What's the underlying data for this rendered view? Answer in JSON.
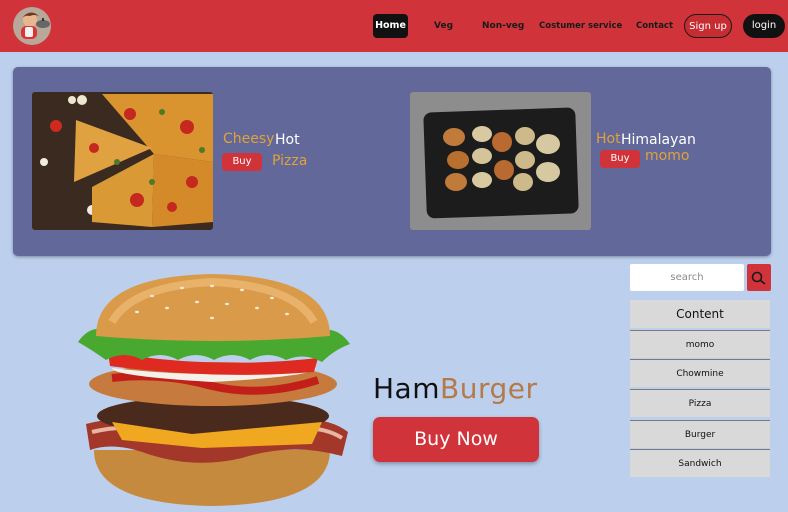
{
  "brand": {
    "logo_icon": "chef-mascot-icon"
  },
  "nav": {
    "home": "Home",
    "veg": "Veg",
    "nonveg": "Non-veg",
    "service": "Costumer service",
    "contact": "Contact",
    "signup": "Sign up",
    "login": "login"
  },
  "banner": {
    "pizza": {
      "word1": "Cheesy",
      "word2": "Hot",
      "word3": "Pizza",
      "buy": "Buy"
    },
    "momo": {
      "word1": "Hot",
      "word2": "Himalayan",
      "word3": "momo",
      "buy": "Buy"
    }
  },
  "hero": {
    "title_a": "Ham",
    "title_b": "Burger",
    "buy": "Buy Now"
  },
  "sidebar": {
    "search_placeholder": "search",
    "content_label": "Content",
    "items": [
      "momo",
      "Chowmine",
      "Pizza",
      "Burger",
      "Sandwich"
    ]
  },
  "colors": {
    "nav": "#d0343a",
    "page": "#bcd0ee",
    "banner": "#626899",
    "accent_gold": "#e0a23a",
    "title_brown": "#b57a4a"
  }
}
